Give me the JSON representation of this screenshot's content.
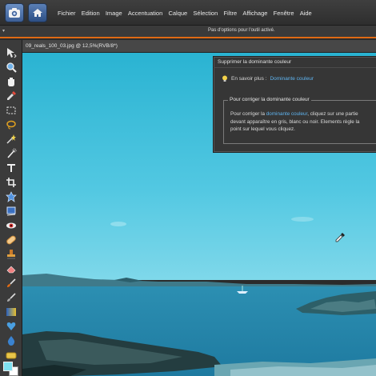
{
  "menubar": {
    "items": [
      "Fichier",
      "Edition",
      "Image",
      "Accentuation",
      "Calque",
      "Sélection",
      "Filtre",
      "Affichage",
      "Fenêtre",
      "Aide"
    ]
  },
  "options_bar": {
    "message": "Pas d'options pour l'outil activé."
  },
  "document": {
    "title": "09_reals_100_03.jpg @ 12,5%(RVB/8*)"
  },
  "panel": {
    "title": "Supprimer la dominante couleur",
    "learn_label": "En savoir plus :",
    "learn_link": "Dominante couleur",
    "section_title": "Pour corriger la dominante couleur",
    "instr_line1_pre": "Pour corriger la ",
    "instr_line1_link": "dominante couleur",
    "instr_line1_post": ", cliquez sur une partie",
    "instr_line2": "devant apparaître en gris, blanc ou noir. Elements règle la",
    "instr_line3": "point sur lequel vous cliquez."
  },
  "colors": {
    "accent": "#e06a14",
    "link": "#5fb4f0",
    "foreground_swatch": "#7ee0f0",
    "background_swatch": "#ffffff"
  },
  "toolbox": {
    "tools": [
      "move-icon",
      "zoom-icon",
      "hand-icon",
      "eyedropper-icon",
      "marquee-icon",
      "lasso-icon",
      "magic-wand-icon",
      "quick-selection-icon",
      "type-icon",
      "crop-icon",
      "cookie-cutter-icon",
      "straighten-icon",
      "red-eye-icon",
      "healing-brush-icon",
      "clone-stamp-icon",
      "eraser-icon",
      "brush-icon",
      "smart-brush-icon",
      "gradient-icon",
      "shape-icon",
      "blur-icon",
      "sponge-icon"
    ]
  }
}
